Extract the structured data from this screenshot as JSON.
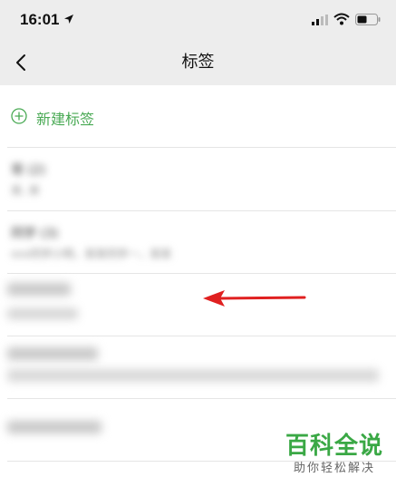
{
  "status_bar": {
    "time": "16:01"
  },
  "nav": {
    "title": "标签"
  },
  "new_tag": {
    "label": "新建标签"
  },
  "tags": [
    {
      "name": "哥 (2)",
      "members": "弟, 弟"
    },
    {
      "name": "同学 (3)",
      "members": "xxx同学小明，某某同学一，某某"
    },
    {
      "name": "",
      "members": ""
    },
    {
      "name": "",
      "members": ""
    },
    {
      "name": "",
      "members": ""
    }
  ],
  "watermark": {
    "title": "百科全说",
    "subtitle": "助你轻松解决"
  },
  "colors": {
    "accent": "#4aaa55",
    "arrow": "#e02020",
    "bar_bg": "#ededed"
  }
}
